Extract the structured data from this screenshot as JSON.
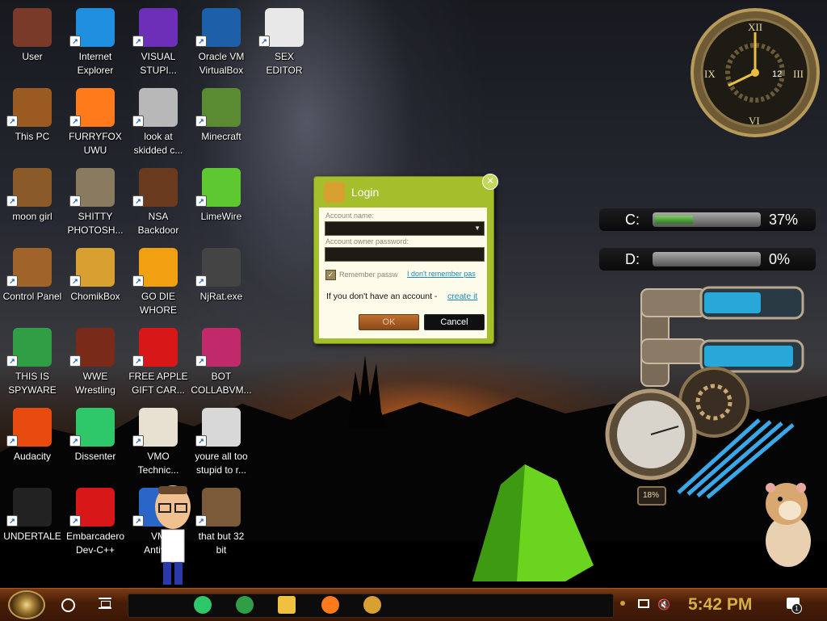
{
  "desktop": {
    "icons": [
      {
        "label": "User",
        "icon": "user-folder-icon",
        "color": "#7a3a2a"
      },
      {
        "label": "Internet\nExplorer",
        "icon": "edge-browser-icon",
        "color": "#1f8fe0"
      },
      {
        "label": "VISUAL\nSTUPI...",
        "icon": "visual-studio-icon",
        "color": "#6e2fb8"
      },
      {
        "label": "Oracle VM\nVirtualBox",
        "icon": "virtualbox-icon",
        "color": "#1d5fa8"
      },
      {
        "label": "SEX\nEDITOR",
        "icon": "hex-editor-icon",
        "color": "#e8e8e8"
      },
      {
        "label": "This PC",
        "icon": "this-pc-icon",
        "color": "#9a5a22"
      },
      {
        "label": "FURRYFOX\nUWU",
        "icon": "firefox-icon",
        "color": "#ff7a1a"
      },
      {
        "label": "look at\nskidded c...",
        "icon": "folder-stack-icon",
        "color": "#b8b8b8"
      },
      {
        "label": "Minecraft",
        "icon": "minecraft-icon",
        "color": "#5a8a32"
      },
      {
        "label": "moon girl",
        "icon": "moon-girl-icon",
        "color": "#8a5a28"
      },
      {
        "label": "SHITTY\nPHOTOSH...",
        "icon": "gimp-icon",
        "color": "#8a7a60"
      },
      {
        "label": "NSA\nBackdoor",
        "icon": "nsa-backdoor-icon",
        "color": "#6a3a1e"
      },
      {
        "label": "LimeWire",
        "icon": "limewire-icon",
        "color": "#5ec830"
      },
      {
        "label": "Control Panel",
        "icon": "control-panel-icon",
        "color": "#a0642a"
      },
      {
        "label": "ChomikBox",
        "icon": "chomikbox-icon",
        "color": "#d8a030"
      },
      {
        "label": "GO DIE\nWHORE",
        "icon": "adobe-director-icon",
        "color": "#f0a010"
      },
      {
        "label": "NjRat.exe",
        "icon": "skull-icon",
        "color": "#444444"
      },
      {
        "label": "THIS IS\nSPYWARE",
        "icon": "chrome-icon",
        "color": "#2f9e44"
      },
      {
        "label": "WWE\nWrestling",
        "icon": "wwe-icon",
        "color": "#7a2a18"
      },
      {
        "label": "FREE APPLE\nGIFT CAR...",
        "icon": "apple-icon",
        "color": "#d81818"
      },
      {
        "label": "BOT\nCOLLABVM...",
        "icon": "monitor-icon",
        "color": "#c02a6a"
      },
      {
        "label": "Audacity",
        "icon": "audacity-icon",
        "color": "#e84a10"
      },
      {
        "label": "Dissenter",
        "icon": "dissenter-icon",
        "color": "#2ec86a"
      },
      {
        "label": "VMO\nTechnic...",
        "icon": "doctor-icon",
        "color": "#e8e0d0"
      },
      {
        "label": "youre all too\nstupid to r...",
        "icon": "portrait-icon",
        "color": "#d8d8d8"
      },
      {
        "label": "UNDERTALE",
        "icon": "unity-icon",
        "color": "#222222"
      },
      {
        "label": "Embarcadero\nDev-C++",
        "icon": "devcpp-icon",
        "color": "#d81818"
      },
      {
        "label": "VM\nAntiv...",
        "icon": "antivirus-icon",
        "color": "#2a66c8"
      },
      {
        "label": "that but 32\nbit",
        "icon": "painting-icon",
        "color": "#7a5a38"
      }
    ]
  },
  "login_dialog": {
    "title": "Login",
    "account_name_label": "Account name:",
    "password_label": "Account owner password:",
    "remember_label": "Remember passw",
    "forgot_link": "I don't remember pas",
    "no_account_text": "If you don't have an account -",
    "create_link": "create it",
    "ok_label": "OK",
    "cancel_label": "Cancel",
    "close_glyph": "✕"
  },
  "clock_widget": {
    "numeral_12": "XII",
    "numeral_3": "III",
    "numeral_6": "VI",
    "numeral_9": "IX",
    "day_number": "12"
  },
  "drive_gauges": [
    {
      "letter": "C:",
      "percent_text": "37%",
      "fill": 0.37
    },
    {
      "letter": "D:",
      "percent_text": "0%",
      "fill": 0.0
    }
  ],
  "cpu_gauge": {
    "percent_text": "18%"
  },
  "taskbar": {
    "time": "5:42 PM",
    "pinned": [
      {
        "icon": "dissenter-icon",
        "color": "#2ec86a"
      },
      {
        "icon": "chrome-icon",
        "color": "#2f9e44"
      },
      {
        "icon": "file-explorer-icon",
        "color": "#f0c040"
      },
      {
        "icon": "firefox-icon",
        "color": "#ff7a1a"
      },
      {
        "icon": "chomikbox-icon",
        "color": "#d8a030"
      }
    ],
    "notification_count": "1"
  }
}
